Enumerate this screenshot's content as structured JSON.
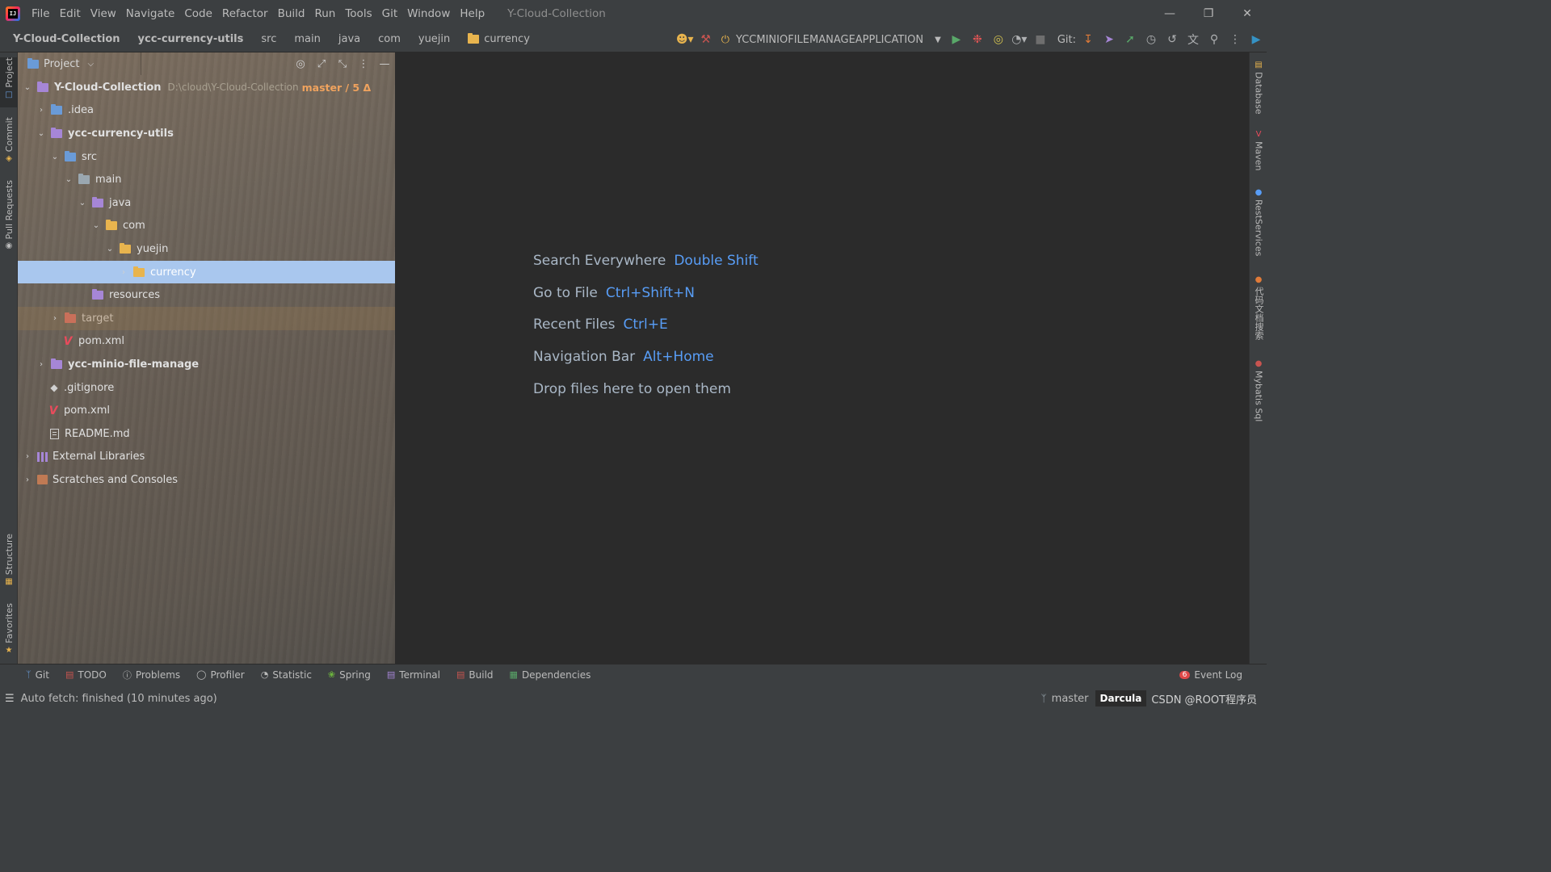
{
  "titlebar": {
    "menu": [
      "File",
      "Edit",
      "View",
      "Navigate",
      "Code",
      "Refactor",
      "Build",
      "Run",
      "Tools",
      "Git",
      "Window",
      "Help"
    ],
    "window_title": "Y-Cloud-Collection"
  },
  "navbar": {
    "crumbs": [
      "Y-Cloud-Collection",
      "ycc-currency-utils",
      "src",
      "main",
      "java",
      "com",
      "yuejin",
      "currency"
    ],
    "run_config": "YCCMINIOFILEMANAGEAPPLICATION",
    "git_label": "Git:"
  },
  "left_tabs": [
    "Project",
    "Commit",
    "Pull Requests",
    "Structure",
    "Favorites"
  ],
  "right_tabs": [
    "Database",
    "Maven",
    "RestServices",
    "代码文档搜索",
    "Mybatis Sql"
  ],
  "project_panel": {
    "title": "Project",
    "tree": [
      {
        "label": "Y-Cloud-Collection",
        "path": "D:\\cloud\\Y-Cloud-Collection",
        "branch": "master / 5 Δ"
      },
      {
        "label": ".idea"
      },
      {
        "label": "ycc-currency-utils"
      },
      {
        "label": "src"
      },
      {
        "label": "main"
      },
      {
        "label": "java"
      },
      {
        "label": "com"
      },
      {
        "label": "yuejin"
      },
      {
        "label": "currency"
      },
      {
        "label": "resources"
      },
      {
        "label": "target"
      },
      {
        "label": "pom.xml"
      },
      {
        "label": "ycc-minio-file-manage"
      },
      {
        "label": ".gitignore"
      },
      {
        "label": "pom.xml"
      },
      {
        "label": "README.md"
      },
      {
        "label": "External Libraries"
      },
      {
        "label": "Scratches and Consoles"
      }
    ]
  },
  "editor": {
    "hints": [
      {
        "text": "Search Everywhere",
        "key": "Double Shift"
      },
      {
        "text": "Go to File",
        "key": "Ctrl+Shift+N"
      },
      {
        "text": "Recent Files",
        "key": "Ctrl+E"
      },
      {
        "text": "Navigation Bar",
        "key": "Alt+Home"
      },
      {
        "text": "Drop files here to open them",
        "key": ""
      }
    ]
  },
  "bottom_tabs": [
    "Git",
    "TODO",
    "Problems",
    "Profiler",
    "Statistic",
    "Spring",
    "Terminal",
    "Build",
    "Dependencies"
  ],
  "event_log": {
    "count": "6",
    "label": "Event Log"
  },
  "status": {
    "message": "Auto fetch: finished (10 minutes ago)",
    "branch": "master",
    "theme": "Darcula",
    "watermark": "CSDN @ROOT程序员"
  },
  "colors": {
    "accent_key": "#589df6",
    "selection": "#a9c7ee",
    "editor_bg": "#2b2b2b",
    "ui_bg": "#3c3f41"
  }
}
